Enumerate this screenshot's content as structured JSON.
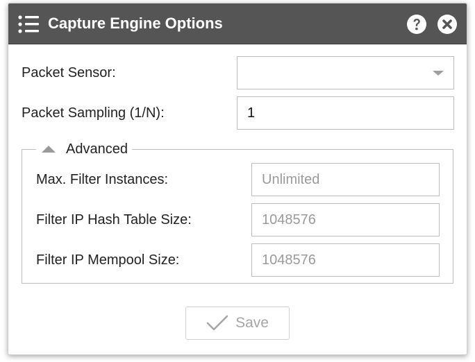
{
  "window": {
    "title": "Capture Engine Options",
    "menu_icon": "list-menu-icon",
    "help_icon": "help-circle-icon",
    "close_icon": "close-circle-icon"
  },
  "form": {
    "packet_sensor": {
      "label": "Packet Sensor:",
      "value": ""
    },
    "packet_sampling": {
      "label": "Packet Sampling (1/N):",
      "value": "1"
    }
  },
  "advanced": {
    "legend": "Advanced",
    "expanded": true,
    "max_filter_instances": {
      "label": "Max. Filter Instances:",
      "placeholder": "Unlimited"
    },
    "filter_ip_hash_table_size": {
      "label": "Filter IP Hash Table Size:",
      "placeholder": "1048576"
    },
    "filter_ip_mempool_size": {
      "label": "Filter IP Mempool Size:",
      "placeholder": "1048576"
    }
  },
  "actions": {
    "save_label": "Save",
    "save_enabled": false
  },
  "colors": {
    "titlebar": "#555555",
    "title_text": "#ffffff",
    "border": "#bdbdbd",
    "muted_text": "#9a9a9a"
  }
}
